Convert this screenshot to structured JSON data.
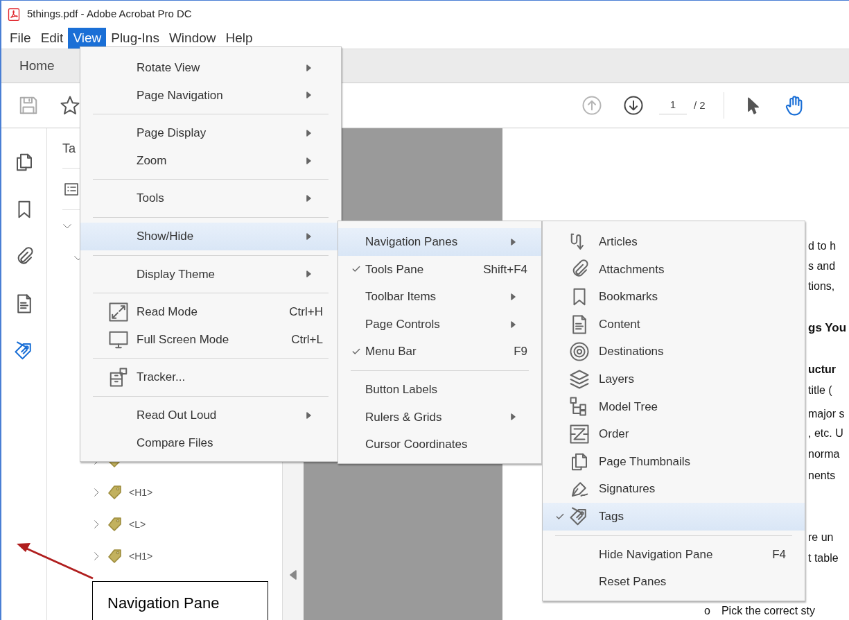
{
  "window": {
    "title": "5things.pdf - Adobe Acrobat Pro DC"
  },
  "menu_bar": [
    {
      "label": "File",
      "selected": false
    },
    {
      "label": "Edit",
      "selected": false
    },
    {
      "label": "View",
      "selected": true
    },
    {
      "label": "Plug-Ins",
      "selected": false
    },
    {
      "label": "Window",
      "selected": false
    },
    {
      "label": "Help",
      "selected": false
    }
  ],
  "tabs": [
    {
      "label": "Home"
    }
  ],
  "toolbar": {
    "previous_page": {
      "disabled": true
    },
    "next_page": {
      "disabled": false
    },
    "page_field": {
      "value": "1"
    },
    "page_count": "/ 2",
    "select_tool": {
      "selected": false
    },
    "hand_tool": {
      "selected": true
    }
  },
  "left_rail": [
    {
      "selected": false
    },
    {
      "selected": false
    },
    {
      "selected": false
    },
    {
      "selected": false
    },
    {
      "selected": true
    }
  ],
  "navigation_pane": {
    "title": "Ta",
    "tree": [
      {
        "expanded": true,
        "children": [
          {
            "expanded": true,
            "children": [
              {
                "expanded": false
              },
              {
                "label": "<H1>",
                "expanded": false
              },
              {
                "label": "<L>",
                "expanded": false
              },
              {
                "label": "<H1>",
                "expanded": false
              }
            ]
          }
        ]
      }
    ]
  },
  "document": {
    "lines": [
      {
        "kind": "text",
        "text": "d to h"
      },
      {
        "kind": "text",
        "text": "s and"
      },
      {
        "kind": "text",
        "text": "tions,"
      },
      {
        "kind": "heading",
        "text": "gs You"
      },
      {
        "kind": "subheading",
        "text": "uctur"
      },
      {
        "kind": "text",
        "text": "title ("
      },
      {
        "kind": "text",
        "text": "major s"
      },
      {
        "kind": "text",
        "text": ", etc. U"
      },
      {
        "kind": "text",
        "text": "norma"
      },
      {
        "kind": "text",
        "text": "nents"
      },
      {
        "kind": "text",
        "text": "re un"
      },
      {
        "kind": "text",
        "text": "t table"
      }
    ],
    "bullet": {
      "marker": "o",
      "text": "Pick the correct sty"
    }
  },
  "menus": [
    {
      "items": [
        {
          "kind": "item",
          "label": "Rotate View",
          "has_submenu": true,
          "selected": false
        },
        {
          "kind": "item",
          "label": "Page Navigation",
          "has_submenu": true,
          "selected": false
        },
        {
          "kind": "separator"
        },
        {
          "kind": "item",
          "label": "Page Display",
          "has_submenu": true,
          "selected": false
        },
        {
          "kind": "item",
          "label": "Zoom",
          "has_submenu": true,
          "selected": false
        },
        {
          "kind": "separator"
        },
        {
          "kind": "item",
          "label": "Tools",
          "has_submenu": true,
          "selected": false
        },
        {
          "kind": "separator"
        },
        {
          "kind": "item",
          "label": "Show/Hide",
          "has_submenu": true,
          "selected": true
        },
        {
          "kind": "separator"
        },
        {
          "kind": "item",
          "label": "Display Theme",
          "has_submenu": true,
          "selected": false
        },
        {
          "kind": "separator"
        },
        {
          "kind": "item",
          "label": "Read Mode",
          "shortcut": "Ctrl+H",
          "has_submenu": false,
          "selected": false
        },
        {
          "kind": "item",
          "label": "Full Screen Mode",
          "shortcut": "Ctrl+L",
          "has_submenu": false,
          "selected": false
        },
        {
          "kind": "separator"
        },
        {
          "kind": "item",
          "label": "Tracker...",
          "has_submenu": false,
          "selected": false
        },
        {
          "kind": "separator"
        },
        {
          "kind": "item",
          "label": "Read Out Loud",
          "has_submenu": true,
          "selected": false
        },
        {
          "kind": "item",
          "label": "Compare Files",
          "has_submenu": false,
          "selected": false
        }
      ]
    },
    {
      "items": [
        {
          "kind": "item",
          "label": "Navigation Panes",
          "has_submenu": true,
          "checked": false,
          "selected": true
        },
        {
          "kind": "item",
          "label": "Tools Pane",
          "shortcut": "Shift+F4",
          "has_submenu": false,
          "checked": true,
          "selected": false
        },
        {
          "kind": "item",
          "label": "Toolbar Items",
          "has_submenu": true,
          "checked": false,
          "selected": false
        },
        {
          "kind": "item",
          "label": "Page Controls",
          "has_submenu": true,
          "checked": false,
          "selected": false
        },
        {
          "kind": "item",
          "label": "Menu Bar",
          "shortcut": "F9",
          "has_submenu": false,
          "checked": true,
          "selected": false
        },
        {
          "kind": "separator"
        },
        {
          "kind": "item",
          "label": "Button Labels",
          "has_submenu": false,
          "checked": false,
          "selected": false
        },
        {
          "kind": "item",
          "label": "Rulers & Grids",
          "has_submenu": true,
          "checked": false,
          "selected": false
        },
        {
          "kind": "item",
          "label": "Cursor Coordinates",
          "has_submenu": false,
          "checked": false,
          "selected": false
        }
      ]
    },
    {
      "items": [
        {
          "kind": "item",
          "label": "Articles",
          "checked": false,
          "selected": false
        },
        {
          "kind": "item",
          "label": "Attachments",
          "checked": false,
          "selected": false
        },
        {
          "kind": "item",
          "label": "Bookmarks",
          "checked": false,
          "selected": false
        },
        {
          "kind": "item",
          "label": "Content",
          "checked": false,
          "selected": false
        },
        {
          "kind": "item",
          "label": "Destinations",
          "checked": false,
          "selected": false
        },
        {
          "kind": "item",
          "label": "Layers",
          "checked": false,
          "selected": false
        },
        {
          "kind": "item",
          "label": "Model Tree",
          "checked": false,
          "selected": false
        },
        {
          "kind": "item",
          "label": "Order",
          "checked": false,
          "selected": false
        },
        {
          "kind": "item",
          "label": "Page Thumbnails",
          "checked": false,
          "selected": false
        },
        {
          "kind": "item",
          "label": "Signatures",
          "checked": false,
          "selected": false
        },
        {
          "kind": "item",
          "label": "Tags",
          "checked": true,
          "selected": true
        },
        {
          "kind": "separator"
        },
        {
          "kind": "item",
          "label": "Hide Navigation Pane",
          "shortcut": "F4",
          "checked": false,
          "selected": false
        },
        {
          "kind": "item",
          "label": "Reset Panes",
          "checked": false,
          "selected": false
        }
      ]
    }
  ],
  "annotation": {
    "label": "Navigation Pane"
  }
}
